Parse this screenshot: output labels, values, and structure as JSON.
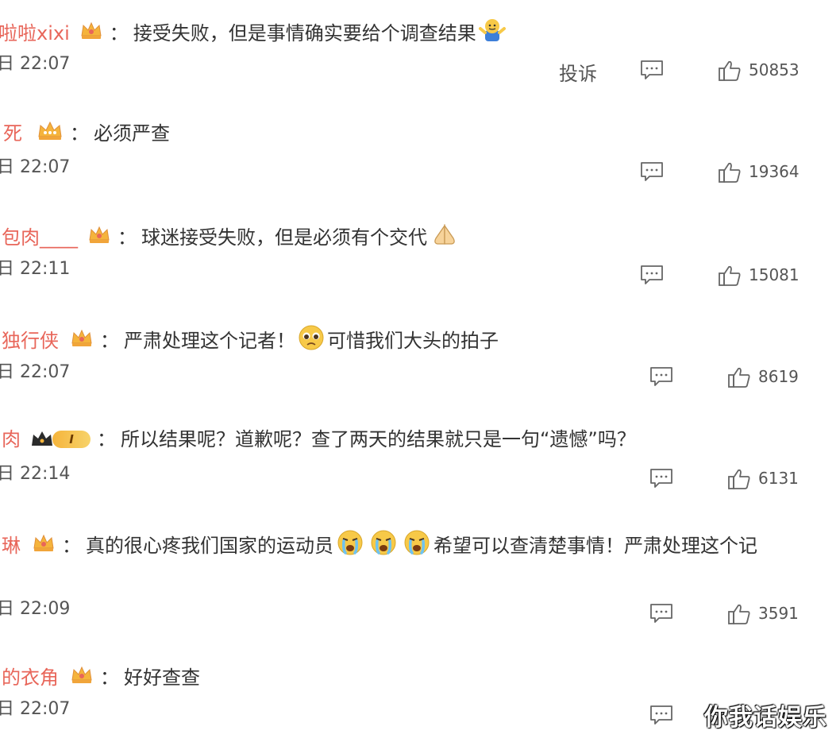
{
  "comments": [
    {
      "username": "啦啦xixi",
      "separator": "：",
      "text_before": "接受失败，但是事情确实要给个调查结果",
      "text_after": "",
      "time": "22:07",
      "report": "投诉",
      "likes": "50853"
    },
    {
      "username": "死",
      "separator": "：",
      "text_before": "必须严查",
      "text_after": "",
      "time": "22:07",
      "likes": "19364"
    },
    {
      "username": "包肉____",
      "separator": "：",
      "text_before": "球迷接受失败，但是必须有个交代",
      "text_after": "",
      "time": "22:11",
      "likes": "15081"
    },
    {
      "username": "独行侠",
      "separator": "：",
      "text_before": "严肃处理这个记者！",
      "text_after": "可惜我们大头的拍子",
      "time": "22:07",
      "likes": "8619"
    },
    {
      "username": "肉",
      "separator": "：",
      "text_before": "所以结果呢？道歉呢？查了两天的结果就只是一句“遗憾”吗？",
      "text_after": "",
      "level_badge": "I",
      "time": "22:14",
      "likes": "6131"
    },
    {
      "username": "琳",
      "separator": "：",
      "text_before": "真的很心疼我们国家的运动员",
      "text_after": "希望可以查清楚事情！严肃处理这个记",
      "time": "22:09",
      "likes": "3591"
    },
    {
      "username": "的衣角",
      "separator": "：",
      "text_before": "好好查查",
      "text_after": "",
      "time": "22:07",
      "likes": ""
    }
  ],
  "icons": {
    "badge": "crown-badge-icon",
    "comment": "comment-icon",
    "like": "thumbs-up-icon",
    "emojis": [
      "shrug-emoji-icon",
      "pray-emoji-icon",
      "pleading-emoji-icon",
      "crying-emoji-icon"
    ]
  },
  "colors": {
    "username": "#e8665a",
    "badge_gold": "#f5b43c",
    "text": "#333333",
    "meta": "#555555"
  },
  "watermark": "你我话娱乐"
}
